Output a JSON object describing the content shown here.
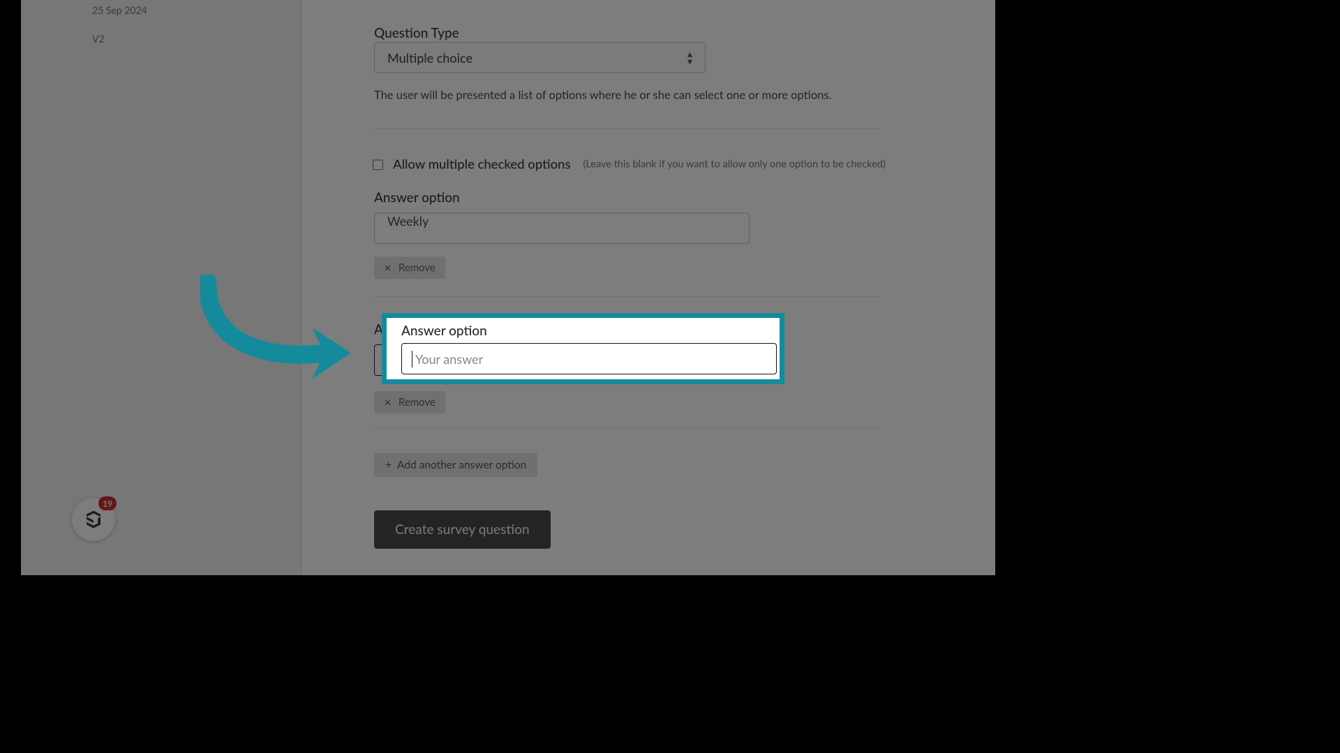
{
  "sidebar": {
    "date": "25 Sep 2024",
    "version": "V2"
  },
  "question_type": {
    "label": "Question Type",
    "selected": "Multiple choice",
    "helper": "The user will be presented a list of options where he or she can select one or more options."
  },
  "allow_multiple": {
    "label": "Allow multiple checked options",
    "hint": "(Leave this blank if you want to allow only one option to be checked)",
    "checked": false
  },
  "answers": {
    "label": "Answer option",
    "placeholder": "Your answer",
    "option1_value": "Weekly",
    "option2_value": "",
    "remove_label": "Remove"
  },
  "buttons": {
    "add_option": "Add another answer option",
    "create": "Create survey question"
  },
  "widget": {
    "badge": "19"
  }
}
